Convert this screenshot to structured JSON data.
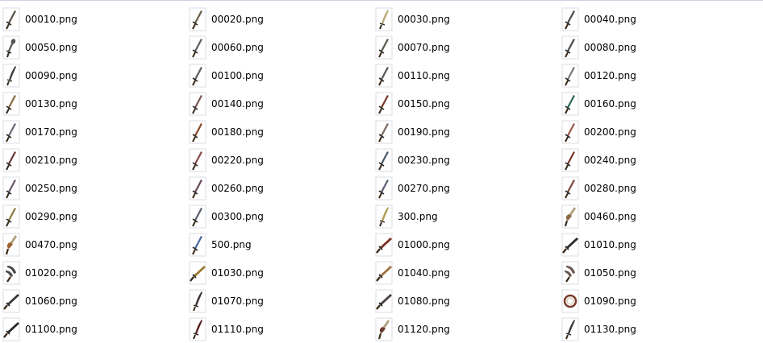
{
  "files": [
    {
      "name": "00010.png",
      "icon": "straight-dagger-icon",
      "color": "#5a5248"
    },
    {
      "name": "00020.png",
      "icon": "straight-dagger-icon",
      "color": "#6b5b4a"
    },
    {
      "name": "00030.png",
      "icon": "curved-blade-icon",
      "color": "#b8a878"
    },
    {
      "name": "00040.png",
      "icon": "straight-dagger-icon",
      "color": "#4a4a4a"
    },
    {
      "name": "00050.png",
      "icon": "hook-blade-icon",
      "color": "#555555"
    },
    {
      "name": "00060.png",
      "icon": "straight-dagger-icon",
      "color": "#606060"
    },
    {
      "name": "00070.png",
      "icon": "straight-dagger-icon",
      "color": "#5b5b52"
    },
    {
      "name": "00080.png",
      "icon": "straight-dagger-icon",
      "color": "#4b4b4b"
    },
    {
      "name": "00090.png",
      "icon": "curved-blade-icon",
      "color": "#3c3c3c"
    },
    {
      "name": "00100.png",
      "icon": "straight-dagger-icon",
      "color": "#5c6060"
    },
    {
      "name": "00110.png",
      "icon": "straight-dagger-icon",
      "color": "#585858"
    },
    {
      "name": "00120.png",
      "icon": "straight-dagger-icon",
      "color": "#7a7a7a"
    },
    {
      "name": "00130.png",
      "icon": "straight-dagger-icon",
      "color": "#8a6a40"
    },
    {
      "name": "00140.png",
      "icon": "straight-dagger-icon",
      "color": "#7a5a5a"
    },
    {
      "name": "00150.png",
      "icon": "straight-dagger-icon",
      "color": "#7a3a2a"
    },
    {
      "name": "00160.png",
      "icon": "straight-dagger-icon",
      "color": "#2f6a5a"
    },
    {
      "name": "00170.png",
      "icon": "straight-dagger-icon",
      "color": "#6a6a7a"
    },
    {
      "name": "00180.png",
      "icon": "straight-dagger-icon",
      "color": "#8a4a2a"
    },
    {
      "name": "00190.png",
      "icon": "straight-dagger-icon",
      "color": "#7a6a60"
    },
    {
      "name": "00200.png",
      "icon": "straight-dagger-icon",
      "color": "#9a5a4a"
    },
    {
      "name": "00210.png",
      "icon": "straight-dagger-icon",
      "color": "#6a3a3a"
    },
    {
      "name": "00220.png",
      "icon": "straight-dagger-icon",
      "color": "#8a4a4a"
    },
    {
      "name": "00230.png",
      "icon": "straight-dagger-icon",
      "color": "#4a5a6a"
    },
    {
      "name": "00240.png",
      "icon": "straight-dagger-icon",
      "color": "#7a3a2a"
    },
    {
      "name": "00250.png",
      "icon": "straight-dagger-icon",
      "color": "#6a5a6a"
    },
    {
      "name": "00260.png",
      "icon": "straight-dagger-icon",
      "color": "#6a4a5a"
    },
    {
      "name": "00270.png",
      "icon": "straight-dagger-icon",
      "color": "#5a6070"
    },
    {
      "name": "00280.png",
      "icon": "straight-dagger-icon",
      "color": "#7a4a3a"
    },
    {
      "name": "00290.png",
      "icon": "straight-dagger-icon",
      "color": "#8a7a40"
    },
    {
      "name": "00300.png",
      "icon": "straight-dagger-icon",
      "color": "#5a6070"
    },
    {
      "name": "300.png",
      "icon": "curved-blade-icon",
      "color": "#b09a50"
    },
    {
      "name": "00460.png",
      "icon": "ornate-blade-icon",
      "color": "#8a6a40"
    },
    {
      "name": "00470.png",
      "icon": "ornate-blade-icon",
      "color": "#a06030"
    },
    {
      "name": "500.png",
      "icon": "straight-dagger-icon",
      "color": "#4a6aa0"
    },
    {
      "name": "01000.png",
      "icon": "diagonal-blade-icon",
      "color": "#7a3020"
    },
    {
      "name": "01010.png",
      "icon": "diagonal-blade-icon",
      "color": "#2a2a2a"
    },
    {
      "name": "01020.png",
      "icon": "claw-blade-icon",
      "color": "#4a4a4a"
    },
    {
      "name": "01030.png",
      "icon": "diagonal-blade-icon",
      "color": "#9a7a30"
    },
    {
      "name": "01040.png",
      "icon": "diagonal-blade-icon",
      "color": "#a07040"
    },
    {
      "name": "01050.png",
      "icon": "claw-blade-icon",
      "color": "#6a5a50"
    },
    {
      "name": "01060.png",
      "icon": "diagonal-blade-icon",
      "color": "#3a3a3a"
    },
    {
      "name": "01070.png",
      "icon": "curved-blade-icon",
      "color": "#3a3030"
    },
    {
      "name": "01080.png",
      "icon": "diagonal-blade-icon",
      "color": "#4a4040"
    },
    {
      "name": "01090.png",
      "icon": "ring-blade-icon",
      "color": "#7a3a2a"
    },
    {
      "name": "01100.png",
      "icon": "diagonal-blade-icon",
      "color": "#2a2a2a"
    },
    {
      "name": "01110.png",
      "icon": "curved-blade-icon",
      "color": "#5a2020"
    },
    {
      "name": "01120.png",
      "icon": "ornate-blade-icon",
      "color": "#6a3a2a"
    },
    {
      "name": "01130.png",
      "icon": "curved-blade-icon",
      "color": "#3a3a3a"
    }
  ]
}
